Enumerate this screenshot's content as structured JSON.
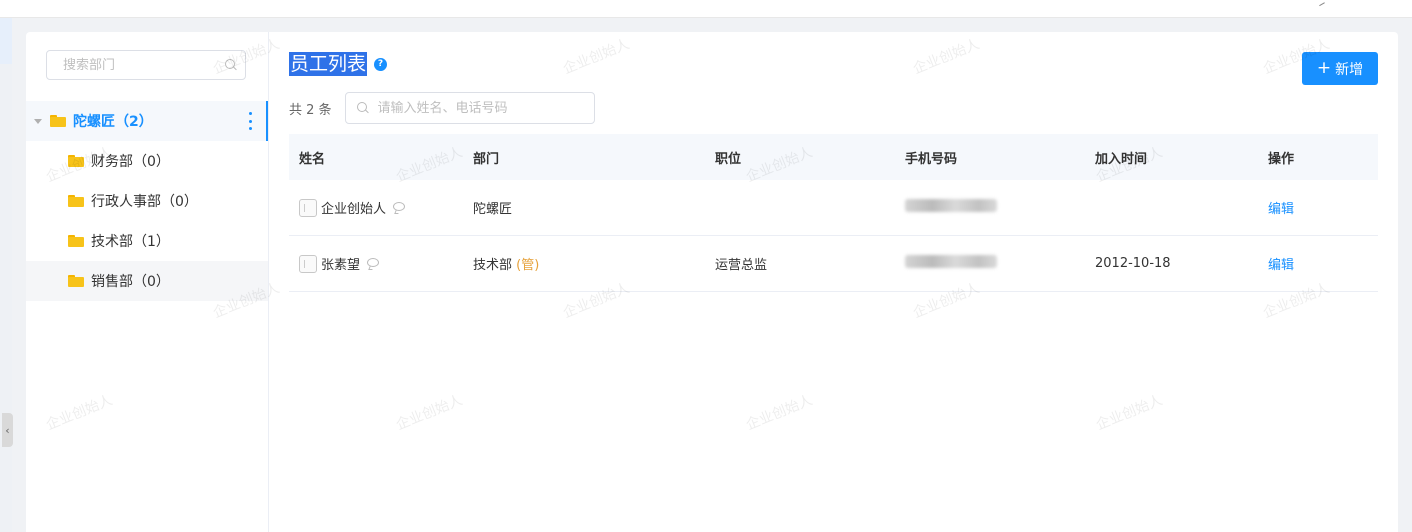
{
  "dept_panel": {
    "search_placeholder": "搜索部门",
    "root": {
      "label": "陀螺匠（2）"
    },
    "children": [
      {
        "label": "财务部（0）"
      },
      {
        "label": "行政人事部（0）"
      },
      {
        "label": "技术部（1）"
      },
      {
        "label": "销售部（0）"
      }
    ]
  },
  "header": {
    "title": "员工列表",
    "help_icon": "question-circle-icon",
    "add_button": "新增"
  },
  "toolbar": {
    "count": "共 2 条",
    "search_placeholder": "请输入姓名、电话号码"
  },
  "table": {
    "columns": [
      "姓名",
      "部门",
      "职位",
      "手机号码",
      "加入时间",
      "操作"
    ],
    "rows": [
      {
        "name": "企业创始人",
        "dept": "陀螺匠",
        "manager_tag": "",
        "position": "",
        "join_date": "",
        "action": "编辑"
      },
      {
        "name": "张素望",
        "dept": "技术部",
        "manager_tag": "(管)",
        "position": "运营总监",
        "join_date": "2012-10-18",
        "action": "编辑"
      }
    ]
  },
  "watermark": "企业创始人",
  "colors": {
    "accent": "#1890ff",
    "manager_tag": "#e6a23c",
    "title_highlight": "#2f72e8"
  }
}
